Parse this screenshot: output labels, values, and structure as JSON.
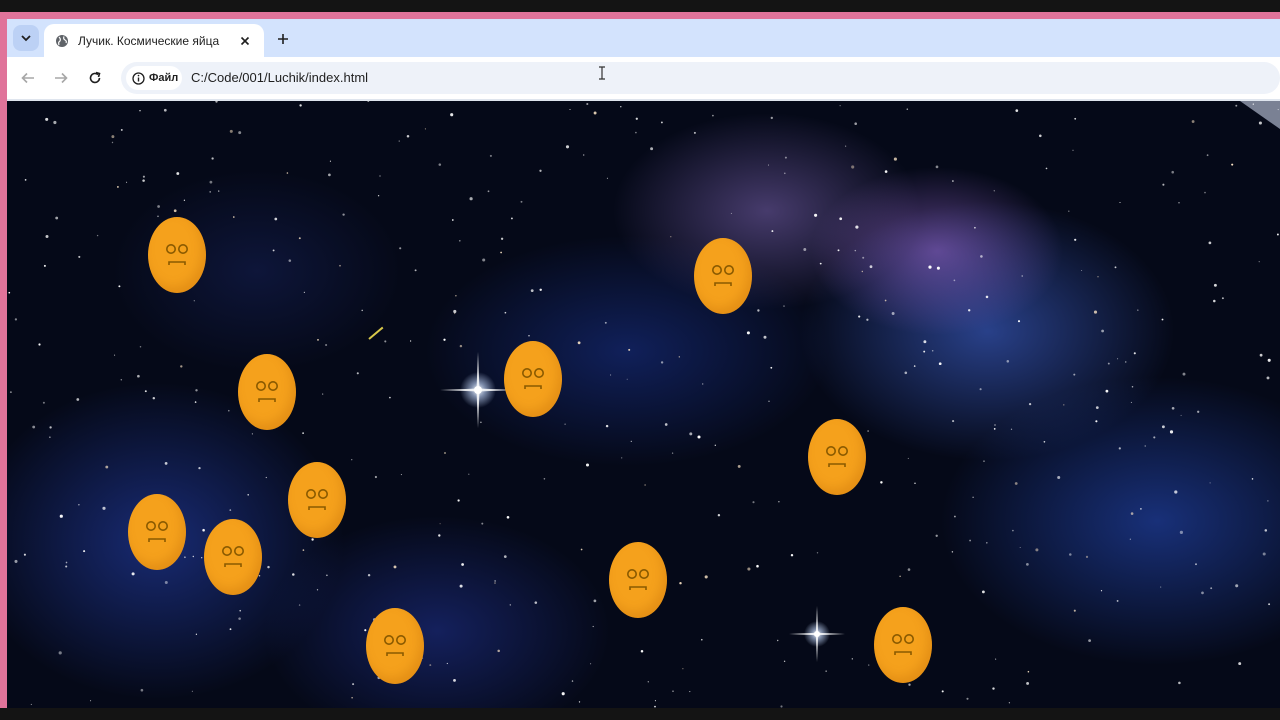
{
  "browser": {
    "tab": {
      "title": "Лучик. Космические яйца",
      "favicon": "globe-icon"
    },
    "address_bar": {
      "site_chip_label": "Файл",
      "site_chip_icon": "info-icon",
      "url": "C:/Code/001/Luchik/index.html"
    },
    "icons": {
      "tab_search": "chevron-down-icon",
      "close_tab": "close-icon",
      "new_tab": "plus-icon",
      "back": "arrow-left-icon",
      "forward": "arrow-right-icon",
      "reload": "reload-icon"
    },
    "colors": {
      "tab_strip": "#d3e3fd",
      "frame_accent": "#e0739a"
    }
  },
  "game": {
    "background": "space-nebula",
    "egg_color": "#f5a11c",
    "egg_face": "sad-face",
    "egg_count": 12
  }
}
